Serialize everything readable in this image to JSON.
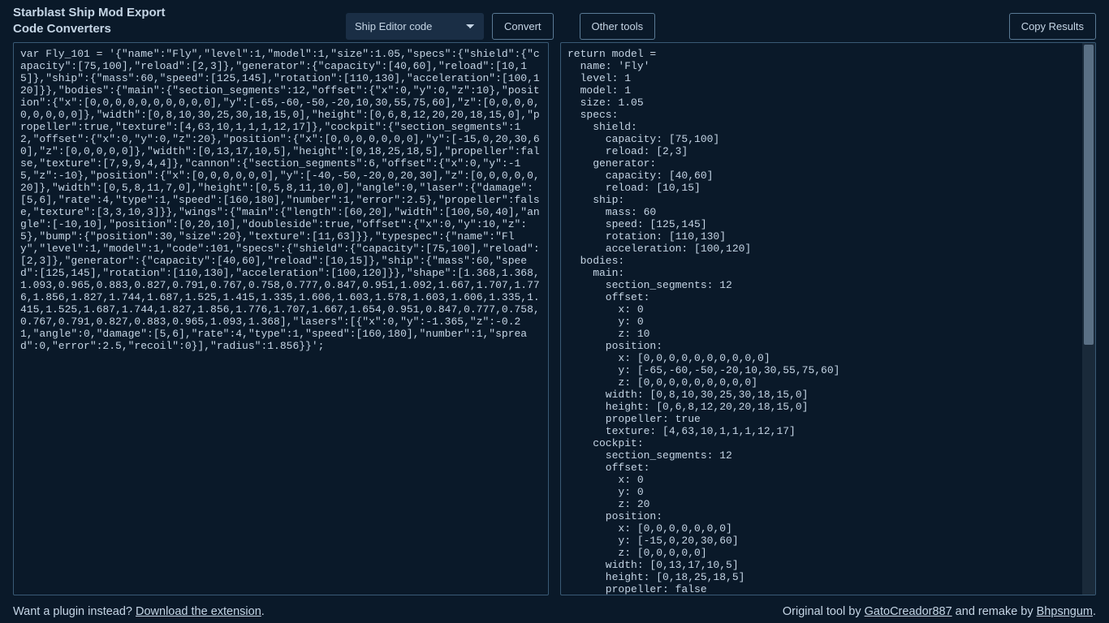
{
  "header": {
    "title_line1": "Starblast Ship Mod Export",
    "title_line2": "Code Converters",
    "dropdown_selected": "Ship Editor code",
    "convert_label": "Convert",
    "other_tools_label": "Other tools",
    "copy_results_label": "Copy Results"
  },
  "left_code": "var Fly_101 = '{\"name\":\"Fly\",\"level\":1,\"model\":1,\"size\":1.05,\"specs\":{\"shield\":{\"capacity\":[75,100],\"reload\":[2,3]},\"generator\":{\"capacity\":[40,60],\"reload\":[10,15]},\"ship\":{\"mass\":60,\"speed\":[125,145],\"rotation\":[110,130],\"acceleration\":[100,120]}},\"bodies\":{\"main\":{\"section_segments\":12,\"offset\":{\"x\":0,\"y\":0,\"z\":10},\"position\":{\"x\":[0,0,0,0,0,0,0,0,0,0],\"y\":[-65,-60,-50,-20,10,30,55,75,60],\"z\":[0,0,0,0,0,0,0,0,0]},\"width\":[0,8,10,30,25,30,18,15,0],\"height\":[0,6,8,12,20,20,18,15,0],\"propeller\":true,\"texture\":[4,63,10,1,1,1,12,17]},\"cockpit\":{\"section_segments\":12,\"offset\":{\"x\":0,\"y\":0,\"z\":20},\"position\":{\"x\":[0,0,0,0,0,0,0],\"y\":[-15,0,20,30,60],\"z\":[0,0,0,0,0]},\"width\":[0,13,17,10,5],\"height\":[0,18,25,18,5],\"propeller\":false,\"texture\":[7,9,9,4,4]},\"cannon\":{\"section_segments\":6,\"offset\":{\"x\":0,\"y\":-15,\"z\":-10},\"position\":{\"x\":[0,0,0,0,0,0],\"y\":[-40,-50,-20,0,20,30],\"z\":[0,0,0,0,0,20]},\"width\":[0,5,8,11,7,0],\"height\":[0,5,8,11,10,0],\"angle\":0,\"laser\":{\"damage\":[5,6],\"rate\":4,\"type\":1,\"speed\":[160,180],\"number\":1,\"error\":2.5},\"propeller\":false,\"texture\":[3,3,10,3]}},\"wings\":{\"main\":{\"length\":[60,20],\"width\":[100,50,40],\"angle\":[-10,10],\"position\":[0,20,10],\"doubleside\":true,\"offset\":{\"x\":0,\"y\":10,\"z\":5},\"bump\":{\"position\":30,\"size\":20},\"texture\":[11,63]}},\"typespec\":{\"name\":\"Fly\",\"level\":1,\"model\":1,\"code\":101,\"specs\":{\"shield\":{\"capacity\":[75,100],\"reload\":[2,3]},\"generator\":{\"capacity\":[40,60],\"reload\":[10,15]},\"ship\":{\"mass\":60,\"speed\":[125,145],\"rotation\":[110,130],\"acceleration\":[100,120]}},\"shape\":[1.368,1.368,1.093,0.965,0.883,0.827,0.791,0.767,0.758,0.777,0.847,0.951,1.092,1.667,1.707,1.776,1.856,1.827,1.744,1.687,1.525,1.415,1.335,1.606,1.603,1.578,1.603,1.606,1.335,1.415,1.525,1.687,1.744,1.827,1.856,1.776,1.707,1.667,1.654,0.951,0.847,0.777,0.758,0.767,0.791,0.827,0.883,0.965,1.093,1.368],\"lasers\":[{\"x\":0,\"y\":-1.365,\"z\":-0.21,\"angle\":0,\"damage\":[5,6],\"rate\":4,\"type\":1,\"speed\":[160,180],\"number\":1,\"spread\":0,\"error\":2.5,\"recoil\":0}],\"radius\":1.856}}';",
  "right_code": "return model =\n  name: 'Fly'\n  level: 1\n  model: 1\n  size: 1.05\n  specs:\n    shield:\n      capacity: [75,100]\n      reload: [2,3]\n    generator:\n      capacity: [40,60]\n      reload: [10,15]\n    ship:\n      mass: 60\n      speed: [125,145]\n      rotation: [110,130]\n      acceleration: [100,120]\n  bodies:\n    main:\n      section_segments: 12\n      offset:\n        x: 0\n        y: 0\n        z: 10\n      position:\n        x: [0,0,0,0,0,0,0,0,0,0]\n        y: [-65,-60,-50,-20,10,30,55,75,60]\n        z: [0,0,0,0,0,0,0,0,0]\n      width: [0,8,10,30,25,30,18,15,0]\n      height: [0,6,8,12,20,20,18,15,0]\n      propeller: true\n      texture: [4,63,10,1,1,1,12,17]\n    cockpit:\n      section_segments: 12\n      offset:\n        x: 0\n        y: 0\n        z: 20\n      position:\n        x: [0,0,0,0,0,0,0]\n        y: [-15,0,20,30,60]\n        z: [0,0,0,0,0]\n      width: [0,13,17,10,5]\n      height: [0,18,25,18,5]\n      propeller: false",
  "footer": {
    "plugin_text": "Want a plugin instead? ",
    "plugin_link": "Download the extension",
    "credit_prefix": "Original tool by ",
    "credit_author1": "GatoCreador887",
    "credit_middle": " and remake by ",
    "credit_author2": "Bhpsngum",
    "period": "."
  }
}
